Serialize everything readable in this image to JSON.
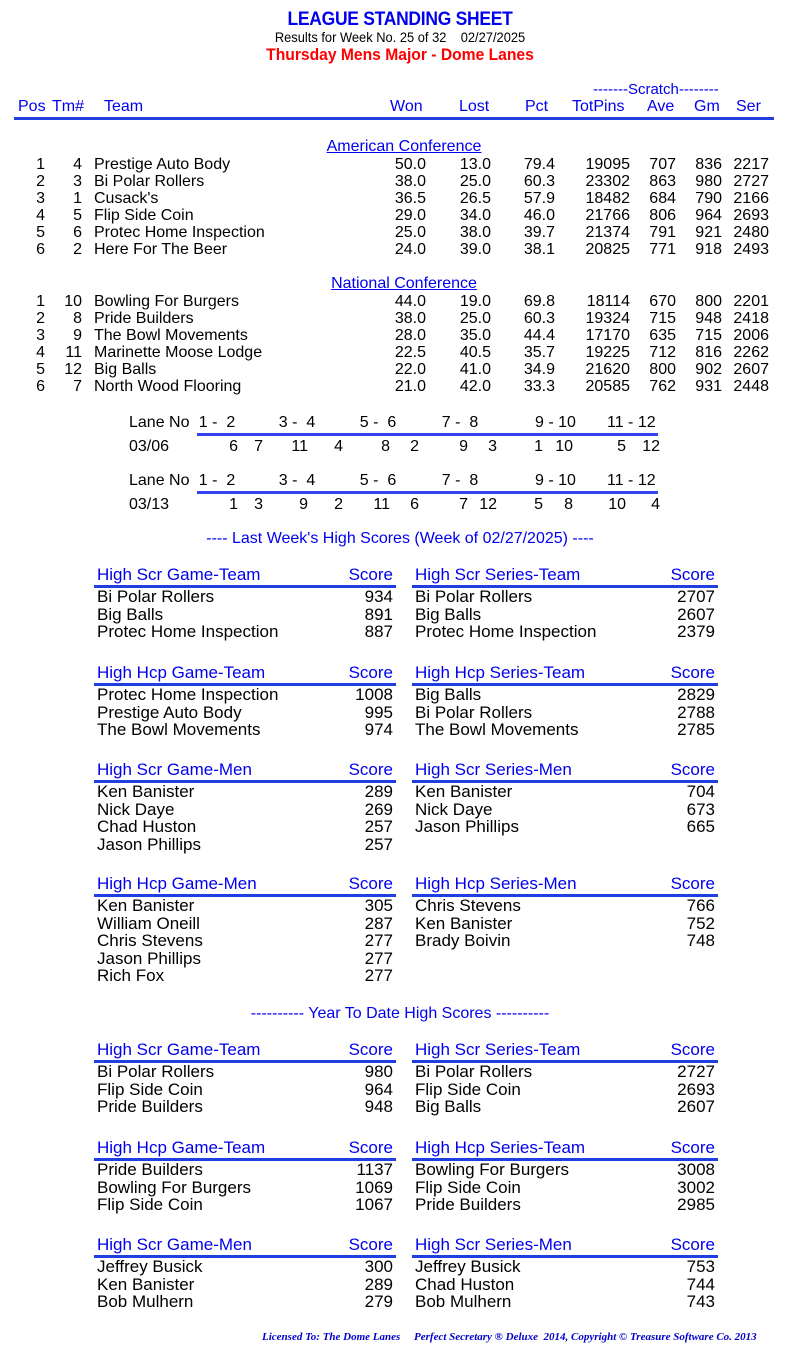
{
  "header": {
    "title": "LEAGUE STANDING SHEET",
    "subtitle": "Results for Week No. 25 of 32    02/27/2025",
    "league": "Thursday Mens Major - Dome Lanes"
  },
  "standings": {
    "scratch_label": "-------Scratch--------",
    "columns": [
      "Pos",
      "Tm#",
      "Team",
      "Won",
      "Lost",
      "Pct",
      "TotPins",
      "Ave",
      "Gm",
      "Ser"
    ],
    "conferences": [
      {
        "name": "American Conference",
        "rows": [
          {
            "pos": "1",
            "tm": "4",
            "team": "Prestige Auto Body",
            "won": "50.0",
            "lost": "13.0",
            "pct": "79.4",
            "totpins": "19095",
            "ave": "707",
            "gm": "836",
            "ser": "2217"
          },
          {
            "pos": "2",
            "tm": "3",
            "team": "Bi Polar Rollers",
            "won": "38.0",
            "lost": "25.0",
            "pct": "60.3",
            "totpins": "23302",
            "ave": "863",
            "gm": "980",
            "ser": "2727"
          },
          {
            "pos": "3",
            "tm": "1",
            "team": "Cusack's",
            "won": "36.5",
            "lost": "26.5",
            "pct": "57.9",
            "totpins": "18482",
            "ave": "684",
            "gm": "790",
            "ser": "2166"
          },
          {
            "pos": "4",
            "tm": "5",
            "team": "Flip Side Coin",
            "won": "29.0",
            "lost": "34.0",
            "pct": "46.0",
            "totpins": "21766",
            "ave": "806",
            "gm": "964",
            "ser": "2693"
          },
          {
            "pos": "5",
            "tm": "6",
            "team": "Protec Home Inspection",
            "won": "25.0",
            "lost": "38.0",
            "pct": "39.7",
            "totpins": "21374",
            "ave": "791",
            "gm": "921",
            "ser": "2480"
          },
          {
            "pos": "6",
            "tm": "2",
            "team": "Here For The Beer",
            "won": "24.0",
            "lost": "39.0",
            "pct": "38.1",
            "totpins": "20825",
            "ave": "771",
            "gm": "918",
            "ser": "2493"
          }
        ]
      },
      {
        "name": "National Conference",
        "rows": [
          {
            "pos": "1",
            "tm": "10",
            "team": "Bowling For Burgers",
            "won": "44.0",
            "lost": "19.0",
            "pct": "69.8",
            "totpins": "18114",
            "ave": "670",
            "gm": "800",
            "ser": "2201"
          },
          {
            "pos": "2",
            "tm": "8",
            "team": "Pride Builders",
            "won": "38.0",
            "lost": "25.0",
            "pct": "60.3",
            "totpins": "19324",
            "ave": "715",
            "gm": "948",
            "ser": "2418"
          },
          {
            "pos": "3",
            "tm": "9",
            "team": "The Bowl Movements",
            "won": "28.0",
            "lost": "35.0",
            "pct": "44.4",
            "totpins": "17170",
            "ave": "635",
            "gm": "715",
            "ser": "2006"
          },
          {
            "pos": "4",
            "tm": "11",
            "team": "Marinette Moose Lodge",
            "won": "22.5",
            "lost": "40.5",
            "pct": "35.7",
            "totpins": "19225",
            "ave": "712",
            "gm": "816",
            "ser": "2262"
          },
          {
            "pos": "5",
            "tm": "12",
            "team": "Big Balls",
            "won": "22.0",
            "lost": "41.0",
            "pct": "34.9",
            "totpins": "21620",
            "ave": "800",
            "gm": "902",
            "ser": "2607"
          },
          {
            "pos": "6",
            "tm": "7",
            "team": "North Wood Flooring",
            "won": "21.0",
            "lost": "42.0",
            "pct": "33.3",
            "totpins": "20585",
            "ave": "762",
            "gm": "931",
            "ser": "2448"
          }
        ]
      }
    ]
  },
  "lane_assignments": {
    "label": "Lane No",
    "lanes": [
      "1 -  2",
      "3 -  4",
      "5 -  6",
      "7 -  8",
      "9 - 10",
      "11 - 12"
    ],
    "weeks": [
      {
        "date": "03/06",
        "pairs": [
          [
            "6",
            "7"
          ],
          [
            "11",
            "4"
          ],
          [
            "8",
            "2"
          ],
          [
            "9",
            "3"
          ],
          [
            "1",
            "10"
          ],
          [
            "5",
            "12"
          ]
        ]
      },
      {
        "date": "03/13",
        "pairs": [
          [
            "1",
            "3"
          ],
          [
            "9",
            "2"
          ],
          [
            "11",
            "6"
          ],
          [
            "7",
            "12"
          ],
          [
            "5",
            "8"
          ],
          [
            "10",
            "4"
          ]
        ]
      }
    ]
  },
  "last_week": {
    "title": "----  Last Week's High Scores   (Week of 02/27/2025)  ----",
    "score_label": "Score",
    "boxes": [
      {
        "title": "High Scr Game-Team",
        "items": [
          [
            "Bi Polar Rollers",
            "934"
          ],
          [
            "Big Balls",
            "891"
          ],
          [
            "Protec Home Inspection",
            "887"
          ]
        ]
      },
      {
        "title": "High Scr Series-Team",
        "items": [
          [
            "Bi Polar Rollers",
            "2707"
          ],
          [
            "Big Balls",
            "2607"
          ],
          [
            "Protec Home Inspection",
            "2379"
          ]
        ]
      },
      {
        "title": "High Hcp Game-Team",
        "items": [
          [
            "Protec Home Inspection",
            "1008"
          ],
          [
            "Prestige Auto Body",
            "995"
          ],
          [
            "The Bowl Movements",
            "974"
          ]
        ]
      },
      {
        "title": "High Hcp Series-Team",
        "items": [
          [
            "Big Balls",
            "2829"
          ],
          [
            "Bi Polar Rollers",
            "2788"
          ],
          [
            "The Bowl Movements",
            "2785"
          ]
        ]
      },
      {
        "title": "High Scr Game-Men",
        "items": [
          [
            "Ken Banister",
            "289"
          ],
          [
            "Nick Daye",
            "269"
          ],
          [
            "Chad Huston",
            "257"
          ],
          [
            "Jason Phillips",
            "257"
          ]
        ]
      },
      {
        "title": "High Scr Series-Men",
        "items": [
          [
            "Ken Banister",
            "704"
          ],
          [
            "Nick Daye",
            "673"
          ],
          [
            "Jason Phillips",
            "665"
          ]
        ]
      },
      {
        "title": "High Hcp Game-Men",
        "items": [
          [
            "Ken Banister",
            "305"
          ],
          [
            "William Oneill",
            "287"
          ],
          [
            "Chris Stevens",
            "277"
          ],
          [
            "Jason Phillips",
            "277"
          ],
          [
            "Rich Fox",
            "277"
          ]
        ]
      },
      {
        "title": "High Hcp Series-Men",
        "items": [
          [
            "Chris Stevens",
            "766"
          ],
          [
            "Ken Banister",
            "752"
          ],
          [
            "Brady Boivin",
            "748"
          ]
        ]
      }
    ]
  },
  "year_to_date": {
    "title": "---------- Year To Date High Scores ----------",
    "score_label": "Score",
    "boxes": [
      {
        "title": "High Scr Game-Team",
        "items": [
          [
            "Bi Polar Rollers",
            "980"
          ],
          [
            "Flip Side Coin",
            "964"
          ],
          [
            "Pride Builders",
            "948"
          ]
        ]
      },
      {
        "title": "High Scr Series-Team",
        "items": [
          [
            "Bi Polar Rollers",
            "2727"
          ],
          [
            "Flip Side Coin",
            "2693"
          ],
          [
            "Big Balls",
            "2607"
          ]
        ]
      },
      {
        "title": "High Hcp Game-Team",
        "items": [
          [
            "Pride Builders",
            "1137"
          ],
          [
            "Bowling For Burgers",
            "1069"
          ],
          [
            "Flip Side Coin",
            "1067"
          ]
        ]
      },
      {
        "title": "High Hcp Series-Team",
        "items": [
          [
            "Bowling For Burgers",
            "3008"
          ],
          [
            "Flip Side Coin",
            "3002"
          ],
          [
            "Pride Builders",
            "2985"
          ]
        ]
      },
      {
        "title": "High Scr Game-Men",
        "items": [
          [
            "Jeffrey Busick",
            "300"
          ],
          [
            "Ken Banister",
            "289"
          ],
          [
            "Bob Mulhern",
            "279"
          ]
        ]
      },
      {
        "title": "High Scr Series-Men",
        "items": [
          [
            "Jeffrey Busick",
            "753"
          ],
          [
            "Chad Huston",
            "744"
          ],
          [
            "Bob Mulhern",
            "743"
          ]
        ]
      }
    ]
  },
  "footer": "Licensed To: The Dome Lanes     Perfect Secretary ® Deluxe  2014, Copyright © Treasure Software Co. 2013"
}
